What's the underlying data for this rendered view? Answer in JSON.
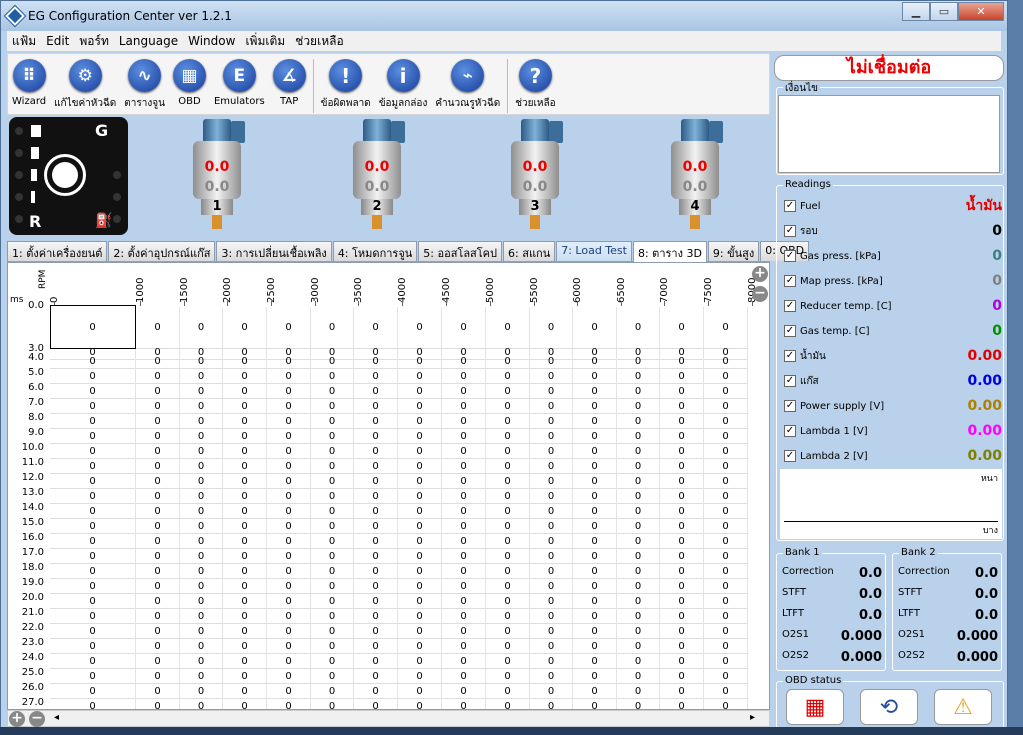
{
  "window": {
    "title": "EG Configuration Center ver 1.2.1",
    "min": "▁",
    "max": "▭",
    "close": "✕"
  },
  "menu": [
    "แฟ้ม",
    "Edit",
    "พอร์ท",
    "Language",
    "Window",
    "เพิ่มเติม",
    "ช่วยเหลือ"
  ],
  "toolbar": [
    {
      "label": "Wizard",
      "icon": "grid-icon",
      "glyph": "⠿"
    },
    {
      "label": "แก้ไขค่าหัวฉีด",
      "icon": "gear-icon",
      "glyph": "⚙"
    },
    {
      "label": "ตารางจูน",
      "icon": "chart-icon",
      "glyph": "∿"
    },
    {
      "label": "OBD",
      "icon": "obd-icon",
      "glyph": "▦"
    },
    {
      "label": "Emulators",
      "icon": "emulator-icon",
      "glyph": "E"
    },
    {
      "label": "TAP",
      "icon": "tap-icon",
      "glyph": "∡"
    },
    {
      "label": "ข้อผิดพลาด",
      "icon": "error-icon",
      "glyph": "!"
    },
    {
      "label": "ข้อมูลกล่อง",
      "icon": "info-icon",
      "glyph": "i"
    },
    {
      "label": "คำนวณรูหัวฉีด",
      "icon": "injector-icon",
      "glyph": "⌁"
    },
    {
      "label": "ช่วยเหลือ",
      "icon": "help-icon",
      "glyph": "?"
    }
  ],
  "gear": {
    "top": "G",
    "bottom": "R"
  },
  "injectors": [
    {
      "num": "1",
      "v1": "0.0",
      "v2": "0.0"
    },
    {
      "num": "2",
      "v1": "0.0",
      "v2": "0.0"
    },
    {
      "num": "3",
      "v1": "0.0",
      "v2": "0.0"
    },
    {
      "num": "4",
      "v1": "0.0",
      "v2": "0.0"
    }
  ],
  "tabs": [
    "1: ตั้งค่าเครื่องยนต์",
    "2: ตั้งค่าอุปกรณ์แก๊ส",
    "3: การเปลี่ยนเชื้อเพลิง",
    "4: โหมดการจูน",
    "5: ออสโลสโคป",
    "6: สแกน",
    "7: Load Test",
    "8: ตาราง 3D",
    "9: ขั้นสูง",
    "0: OBD"
  ],
  "grid": {
    "rpm_label": "RPM",
    "ms_label": "ms",
    "cols": [
      "0",
      "1000",
      "1500",
      "2000",
      "2500",
      "3000",
      "3500",
      "4000",
      "4500",
      "5000",
      "5500",
      "6000",
      "6500",
      "7000",
      "7500",
      "8000"
    ],
    "rows": [
      "0.0",
      "3.0",
      "4.0",
      "5.0",
      "6.0",
      "7.0",
      "8.0",
      "9.0",
      "10.0",
      "11.0",
      "12.0",
      "13.0",
      "14.0",
      "15.0",
      "16.0",
      "17.0",
      "18.0",
      "19.0",
      "20.0",
      "21.0",
      "22.0",
      "23.0",
      "24.0",
      "25.0",
      "26.0",
      "27.0"
    ],
    "value": "0"
  },
  "status": {
    "connection": "ไม่เชื่อมต่อ",
    "condition_title": "เงื่อนไข"
  },
  "readings": {
    "title": "Readings",
    "items": [
      {
        "label": "Fuel",
        "value": "น้ำมัน",
        "color": "#e00000"
      },
      {
        "label": "รอบ",
        "value": "0",
        "color": "#000000"
      },
      {
        "label": "Gas press. [kPa]",
        "value": "0",
        "color": "#3a8080"
      },
      {
        "label": "Map press. [kPa]",
        "value": "0",
        "color": "#808080"
      },
      {
        "label": "Reducer temp. [C]",
        "value": "0",
        "color": "#b000e0"
      },
      {
        "label": "Gas temp. [C]",
        "value": "0",
        "color": "#009000"
      },
      {
        "label": "น้ำมัน",
        "value": "0.00",
        "color": "#e00000"
      },
      {
        "label": "แก๊ส",
        "value": "0.00",
        "color": "#0000e0"
      },
      {
        "label": "Power supply [V]",
        "value": "0.00",
        "color": "#b08000"
      },
      {
        "label": "Lambda 1 [V]",
        "value": "0.00",
        "color": "#ff00ff"
      },
      {
        "label": "Lambda 2 [V]",
        "value": "0.00",
        "color": "#808000"
      }
    ],
    "graph_rich": "หนา",
    "graph_lean": "บาง"
  },
  "bank1": {
    "title": "Bank 1",
    "rows": [
      {
        "label": "Correction",
        "value": "0.0"
      },
      {
        "label": "STFT",
        "value": "0.0"
      },
      {
        "label": "LTFT",
        "value": "0.0"
      },
      {
        "label": "O2S1",
        "value": "0.000"
      },
      {
        "label": "O2S2",
        "value": "0.000"
      }
    ]
  },
  "bank2": {
    "title": "Bank 2",
    "rows": [
      {
        "label": "Correction",
        "value": "0.0"
      },
      {
        "label": "STFT",
        "value": "0.0"
      },
      {
        "label": "LTFT",
        "value": "0.0"
      },
      {
        "label": "O2S1",
        "value": "0.000"
      },
      {
        "label": "O2S2",
        "value": "0.000"
      }
    ]
  },
  "obd": {
    "title": "OBD status"
  }
}
